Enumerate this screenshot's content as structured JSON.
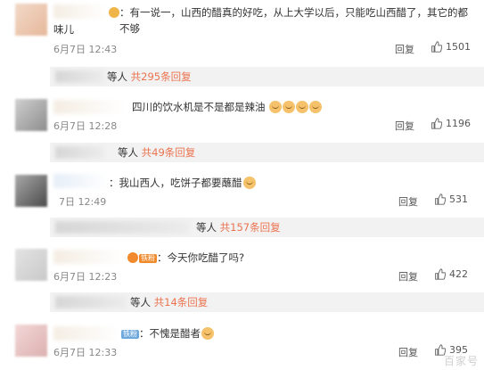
{
  "comments": [
    {
      "text": "有一说一，山西的醋真的好吃，从上大学以后，只能吃山西醋了，其它的都不够",
      "text_cont": "味儿",
      "time": "6月7日 12:43",
      "reply_label": "回复",
      "likes": "1501",
      "sub": {
        "people": "等人",
        "count_text": "共295条回复"
      }
    },
    {
      "text": "四川的饮水机是不是都是辣油",
      "time": "6月7日 12:28",
      "reply_label": "回复",
      "likes": "1196",
      "sub": {
        "people": "等人",
        "count_text": "共49条回复"
      }
    },
    {
      "text": "：我山西人，吃饼子都要蘸醋",
      "time": "7日 12:49",
      "reply_label": "回复",
      "likes": "531",
      "sub": {
        "people": "等人",
        "count_text": "共157条回复"
      }
    },
    {
      "badge": "铁粉",
      "text": "：今天你吃醋了吗?",
      "time": "6月7日 12:23",
      "reply_label": "回复",
      "likes": "422",
      "sub": {
        "people": "等人",
        "count_text": "共14条回复"
      }
    },
    {
      "badge": "铁粉",
      "text": "：不愧是醋者",
      "time": "6月7日 12:33",
      "reply_label": "回复",
      "likes": "395"
    }
  ],
  "watermark": "百家号"
}
